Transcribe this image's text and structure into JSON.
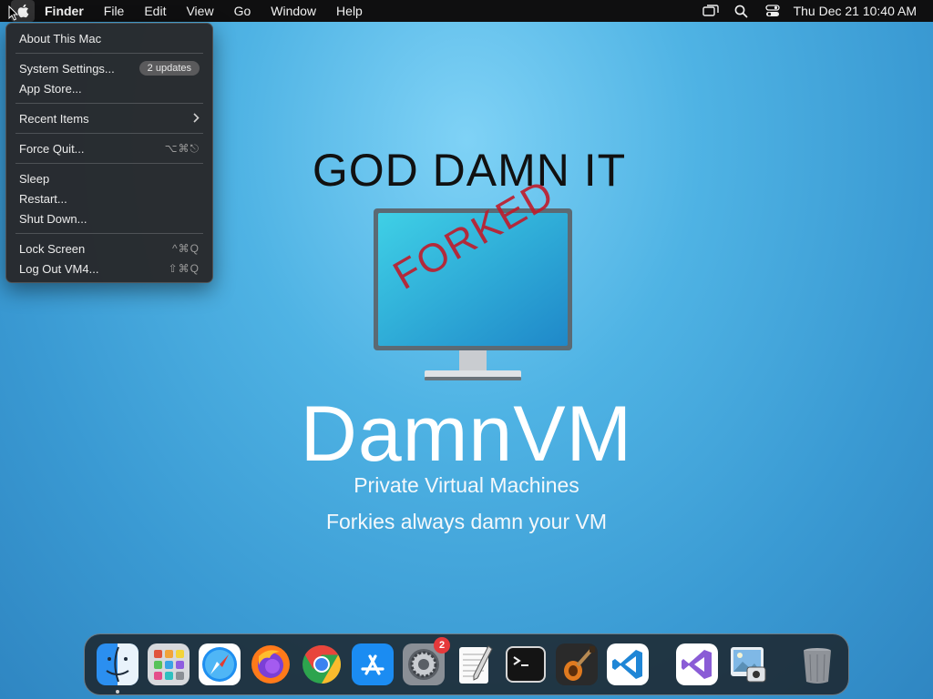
{
  "menubar": {
    "app_name": "Finder",
    "items": [
      "File",
      "Edit",
      "View",
      "Go",
      "Window",
      "Help"
    ],
    "clock": "Thu Dec 21  10:40 AM"
  },
  "apple_menu": {
    "about": "About This Mac",
    "system_settings": "System Settings...",
    "updates_badge": "2 updates",
    "app_store": "App Store...",
    "recent_items": "Recent Items",
    "force_quit": "Force Quit...",
    "force_quit_shortcut": "⌥⌘⎋",
    "sleep": "Sleep",
    "restart": "Restart...",
    "shut_down": "Shut Down...",
    "lock_screen": "Lock Screen",
    "lock_screen_shortcut": "^⌘Q",
    "log_out": "Log Out VM4...",
    "log_out_shortcut": "⇧⌘Q"
  },
  "wallpaper": {
    "headline": "GOD DAMN IT",
    "stamp": "FORKED",
    "brand": "DamnVM",
    "tagline1": "Private Virtual Machines",
    "tagline2": "Forkies always damn your VM"
  },
  "dock": {
    "apps": [
      "finder-icon",
      "launchpad-icon",
      "safari-icon",
      "firefox-icon",
      "chrome-icon",
      "app-store-icon",
      "system-settings-icon",
      "textedit-icon",
      "terminal-icon",
      "garageband-icon",
      "vscode-icon"
    ],
    "system_settings_badge": "2",
    "recent_apps": [
      "visual-studio-icon",
      "preview-icon"
    ],
    "trash": "trash-icon"
  },
  "colors": {
    "menubar_bg": "#0f0f10",
    "wallpaper_blue": "#4fb3e4",
    "stamp_red": "#c01b2a"
  }
}
